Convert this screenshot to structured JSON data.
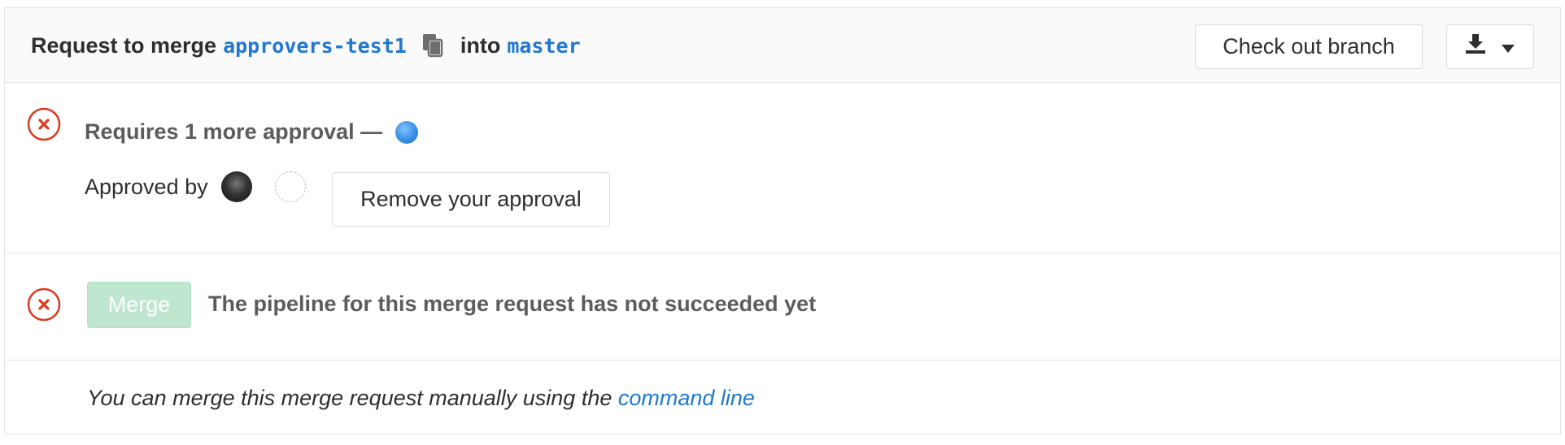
{
  "header": {
    "prefix": "Request to merge",
    "source_branch": "approvers-test1",
    "middle": "into",
    "target_branch": "master",
    "checkout_label": "Check out branch",
    "copy_icon": "clipboard-icon",
    "download_icon": "download-icon",
    "dropdown_icon": "caret-down-icon"
  },
  "approval": {
    "status_icon": "error-circle-icon",
    "title": "Requires 1 more approval —",
    "approved_by_label": "Approved by",
    "remove_label": "Remove your approval"
  },
  "merge": {
    "status_icon": "error-circle-icon",
    "button_label": "Merge",
    "message": "The pipeline for this merge request has not succeeded yet"
  },
  "cli": {
    "text": "You can merge this merge request manually using the",
    "link_label": "command line"
  },
  "colors": {
    "link": "#1f78d1",
    "error": "#db3b21",
    "merge_disabled": "#bfe7d0",
    "header_bg": "#fafafa",
    "border": "#e5e5e5"
  }
}
